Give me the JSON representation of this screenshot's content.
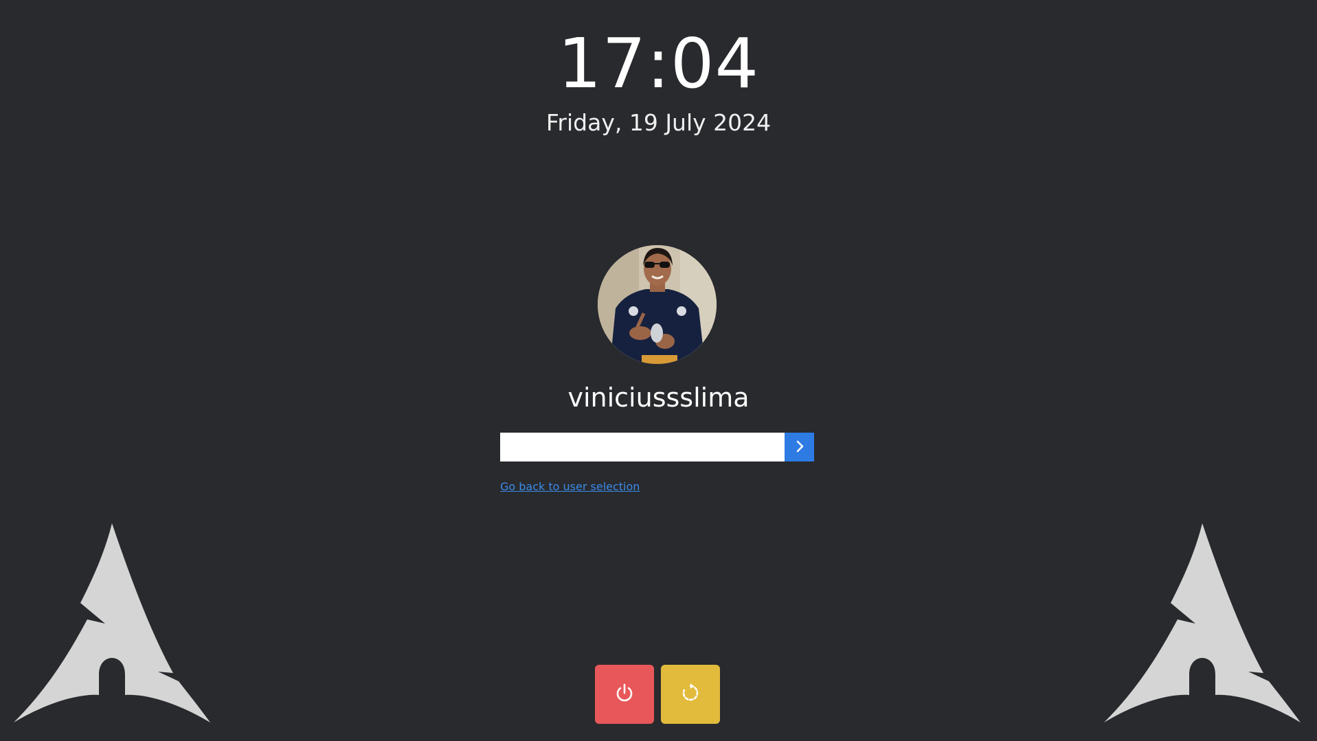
{
  "clock": {
    "time": "17:04",
    "date": "Friday, 19 July 2024"
  },
  "user": {
    "username": "viniciussslima"
  },
  "login": {
    "password_value": "",
    "submit_icon": "chevron-right-icon",
    "back_link": "Go back to user selection"
  },
  "power": {
    "shutdown_icon": "power-icon",
    "restart_icon": "restart-icon"
  },
  "colors": {
    "background": "#292a2e",
    "accent": "#2d7be3",
    "link": "#3a8be8",
    "shutdown": "#e8585a",
    "restart": "#e2bb3d",
    "logo": "#d4d5d4"
  }
}
